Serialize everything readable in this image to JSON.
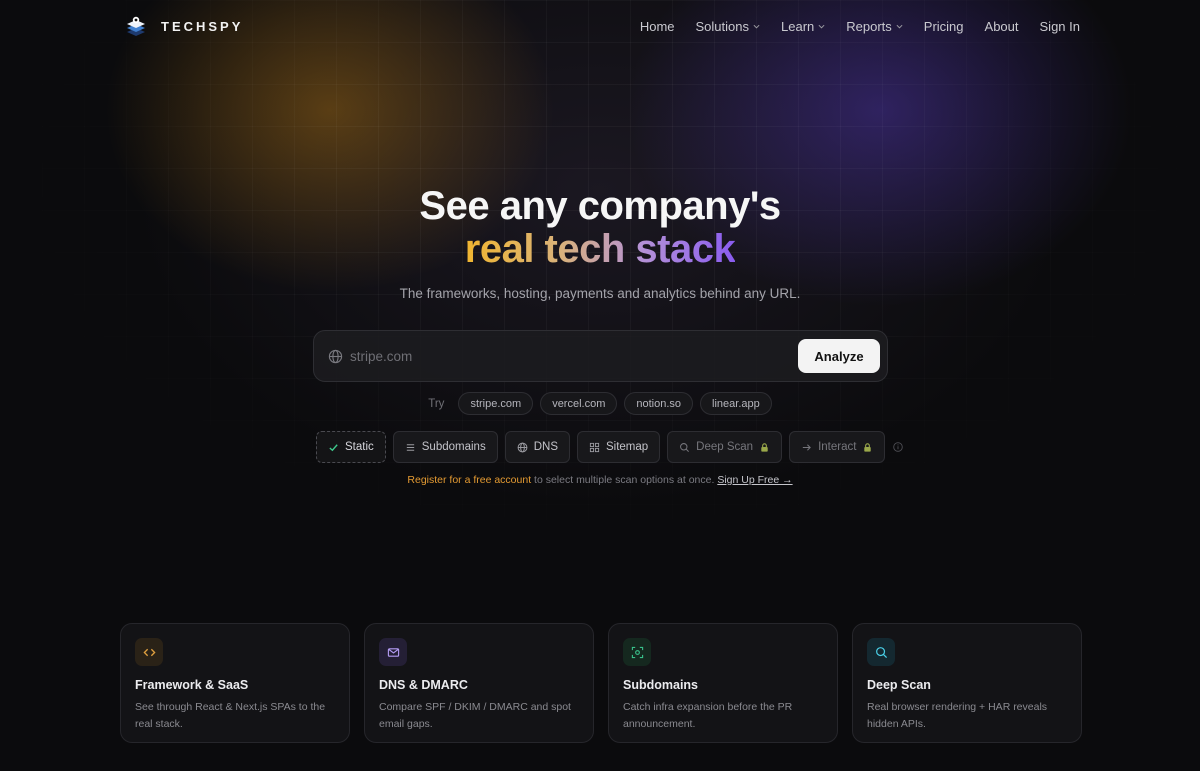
{
  "brand": {
    "name": "TECHSPY"
  },
  "nav": {
    "links": [
      {
        "label": "Home",
        "dropdown": false
      },
      {
        "label": "Solutions",
        "dropdown": true
      },
      {
        "label": "Learn",
        "dropdown": true
      },
      {
        "label": "Reports",
        "dropdown": true
      },
      {
        "label": "Pricing",
        "dropdown": false
      },
      {
        "label": "About",
        "dropdown": false
      },
      {
        "label": "Sign In",
        "dropdown": false
      }
    ]
  },
  "hero": {
    "line1": "See any company's",
    "line2": "real tech stack",
    "subtitle": "The frameworks, hosting, payments and analytics behind any URL."
  },
  "search": {
    "placeholder": "stripe.com",
    "value": "",
    "button_label": "Analyze"
  },
  "try": {
    "label": "Try",
    "chips": [
      "stripe.com",
      "vercel.com",
      "notion.so",
      "linear.app"
    ]
  },
  "options": [
    {
      "label": "Static",
      "icon": "check-icon",
      "active": true,
      "locked": false
    },
    {
      "label": "Subdomains",
      "icon": "list-icon",
      "active": false,
      "locked": false
    },
    {
      "label": "DNS",
      "icon": "globe-icon",
      "active": false,
      "locked": false
    },
    {
      "label": "Sitemap",
      "icon": "grid-icon",
      "active": false,
      "locked": false
    },
    {
      "label": "Deep Scan",
      "icon": "search-icon",
      "active": false,
      "locked": true
    },
    {
      "label": "Interact",
      "icon": "arrow-right-icon",
      "active": false,
      "locked": true
    }
  ],
  "register": {
    "highlight": "Register for a free account",
    "text": " to select multiple scan options at once. ",
    "link": "Sign Up Free →"
  },
  "cards": [
    {
      "title": "Framework & SaaS",
      "desc": "See through React & Next.js SPAs to the real stack.",
      "icon": "code-icon",
      "icon_color": "#e0a040",
      "icon_bg": "#2a2217"
    },
    {
      "title": "DNS & DMARC",
      "desc": "Compare SPF / DKIM / DMARC and spot email gaps.",
      "icon": "mail-icon",
      "icon_color": "#b49cf4",
      "icon_bg": "#241f35"
    },
    {
      "title": "Subdomains",
      "desc": "Catch infra expansion before the PR announcement.",
      "icon": "scan-icon",
      "icon_color": "#38c08a",
      "icon_bg": "#15281f"
    },
    {
      "title": "Deep Scan",
      "desc": "Real browser rendering + HAR reveals hidden APIs.",
      "icon": "search-icon",
      "icon_color": "#4ad0e8",
      "icon_bg": "#142830"
    }
  ],
  "colors": {
    "accent_orange": "#e39a32",
    "accent_purple": "#8a5cf0",
    "background": "#0b0b0d"
  }
}
